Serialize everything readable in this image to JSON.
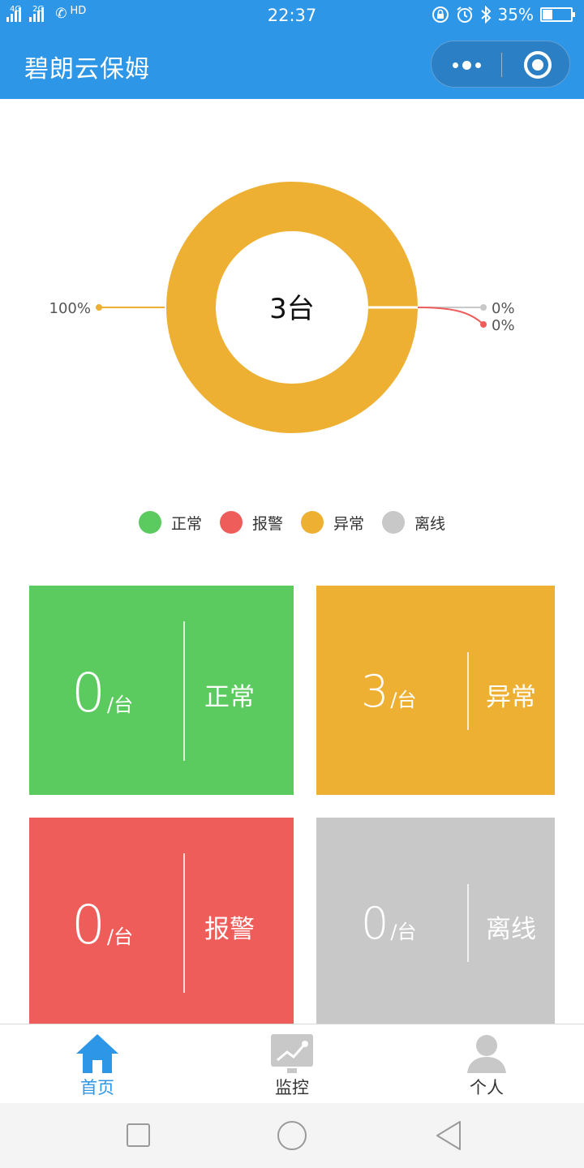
{
  "status_bar": {
    "net1": "4G",
    "net2": "2G",
    "hd": "HD",
    "time": "22:37",
    "battery_text": "35%",
    "battery_level": 0.35
  },
  "nav": {
    "title": "碧朗云保姆"
  },
  "chart_data": {
    "type": "pie",
    "center_label": "3台",
    "categories": [
      "正常",
      "报警",
      "异常",
      "离线"
    ],
    "values": [
      0,
      0,
      3,
      0
    ],
    "colors": [
      "#5bcb5f",
      "#ef5d5b",
      "#eeb033",
      "#c8c8c8"
    ],
    "slice_labels": [
      "100%",
      "0%",
      "0%"
    ],
    "legend_position": "bottom"
  },
  "legend": [
    {
      "label": "正常",
      "color": "#5bcb5f"
    },
    {
      "label": "报警",
      "color": "#ef5d5b"
    },
    {
      "label": "异常",
      "color": "#eeb033"
    },
    {
      "label": "离线",
      "color": "#c8c8c8"
    }
  ],
  "cards": {
    "normal": {
      "count": "0",
      "unit": "/台",
      "label": "正常",
      "color": "#5bcb5f"
    },
    "abnormal": {
      "count": "3",
      "unit": "/台",
      "label": "异常",
      "color": "#eeb033"
    },
    "alarm": {
      "count": "0",
      "unit": "/台",
      "label": "报警",
      "color": "#ef5d5b"
    },
    "offline": {
      "count": "0",
      "unit": "/台",
      "label": "离线",
      "color": "#c8c8c8"
    }
  },
  "tabbar": {
    "home": "首页",
    "monitor": "监控",
    "profile": "个人",
    "active_color": "#2e96e6"
  }
}
